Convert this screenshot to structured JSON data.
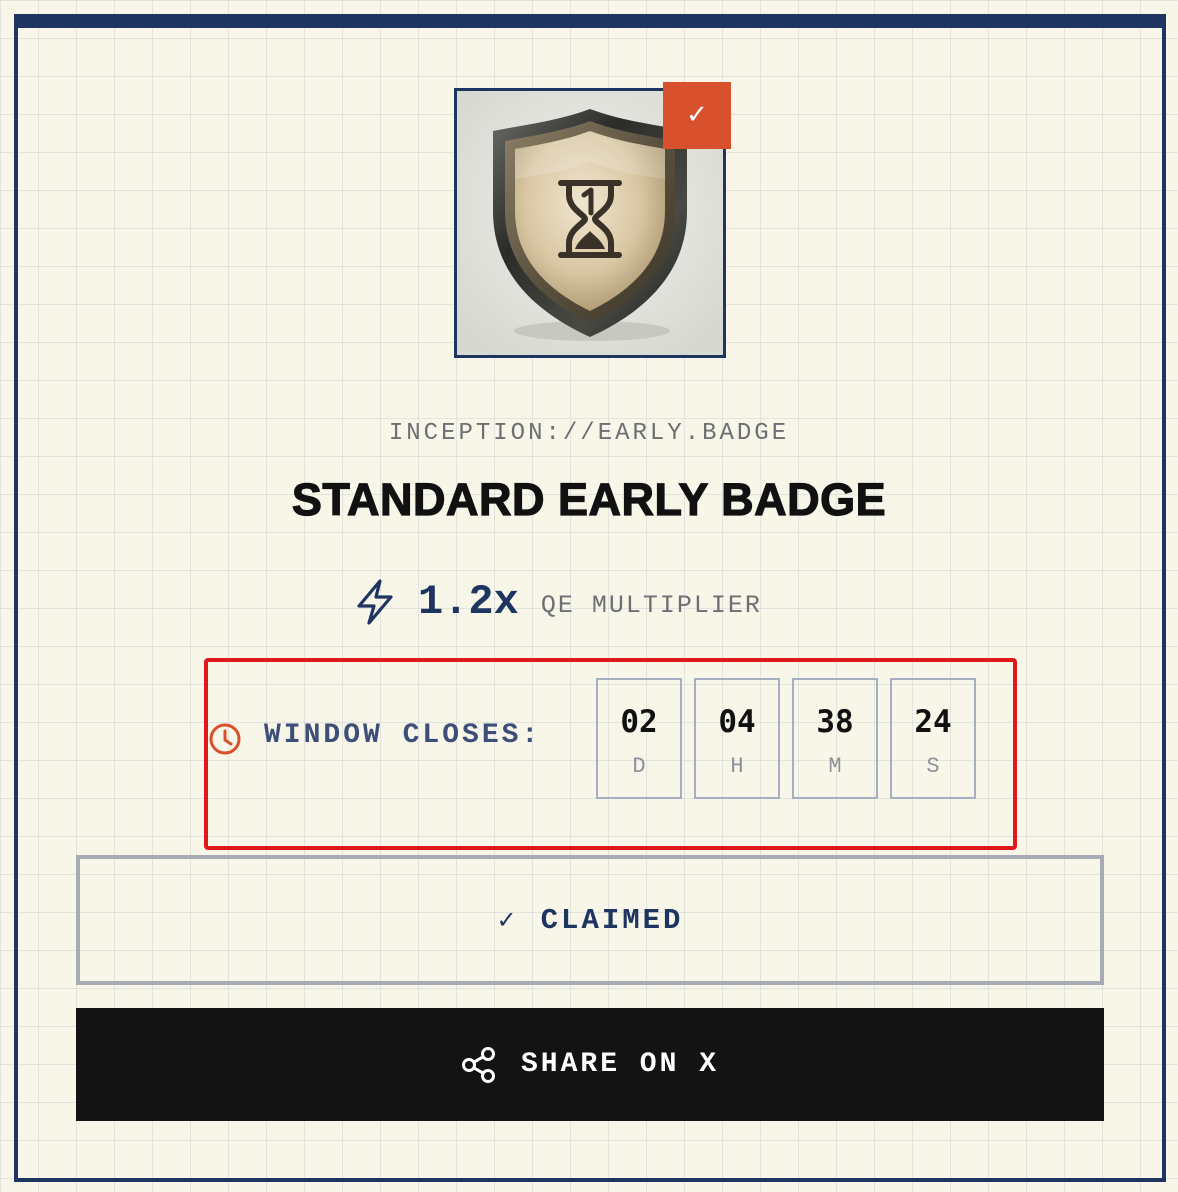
{
  "badge": {
    "image_name": "hourglass-shield-badge",
    "claimed_mark": "✓",
    "protocol": "INCEPTION://EARLY.BADGE",
    "title": "STANDARD EARLY BADGE"
  },
  "multiplier": {
    "icon": "bolt-icon",
    "value": "1.2x",
    "label": "QE MULTIPLIER"
  },
  "countdown": {
    "icon": "clock-icon",
    "label": "WINDOW CLOSES:",
    "units": [
      {
        "value": "02",
        "unit": "D"
      },
      {
        "value": "04",
        "unit": "H"
      },
      {
        "value": "38",
        "unit": "M"
      },
      {
        "value": "24",
        "unit": "S"
      }
    ]
  },
  "actions": {
    "claimed_icon": "✓",
    "claimed_label": "CLAIMED",
    "share_icon": "share-icon",
    "share_label": "SHARE ON X"
  },
  "colors": {
    "navy": "#1f3561",
    "accent": "#d9512c",
    "highlight": "#e0171b",
    "background": "#f7f6e8",
    "share_button": "#131313"
  }
}
